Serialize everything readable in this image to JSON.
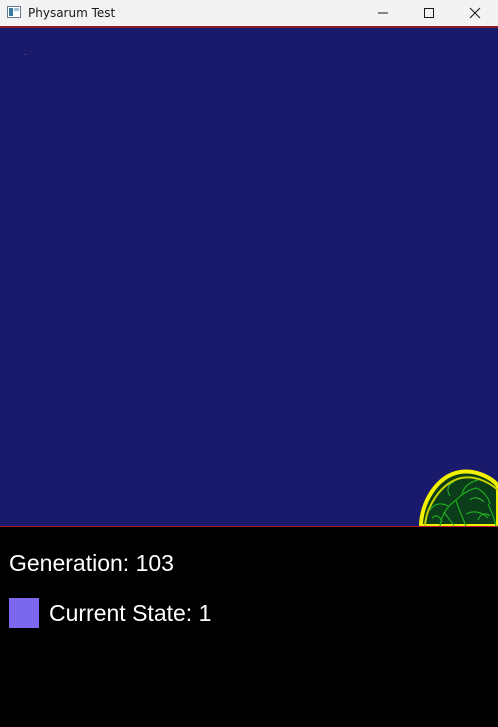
{
  "window": {
    "title": "Physarum Test",
    "icons": {
      "app": "app-window-icon",
      "minimize": "minimize-icon",
      "maximize": "maximize-icon",
      "close": "close-icon"
    }
  },
  "simulation": {
    "background_color": "#1a1a6c",
    "border_color": "#b01a2a",
    "colony_colors": {
      "edge": "#f2f200",
      "trail": "#1faa1f"
    }
  },
  "status": {
    "generation_label": "Generation: 103",
    "state_label": "Current State: 1",
    "state_color": "#7b68ee"
  }
}
